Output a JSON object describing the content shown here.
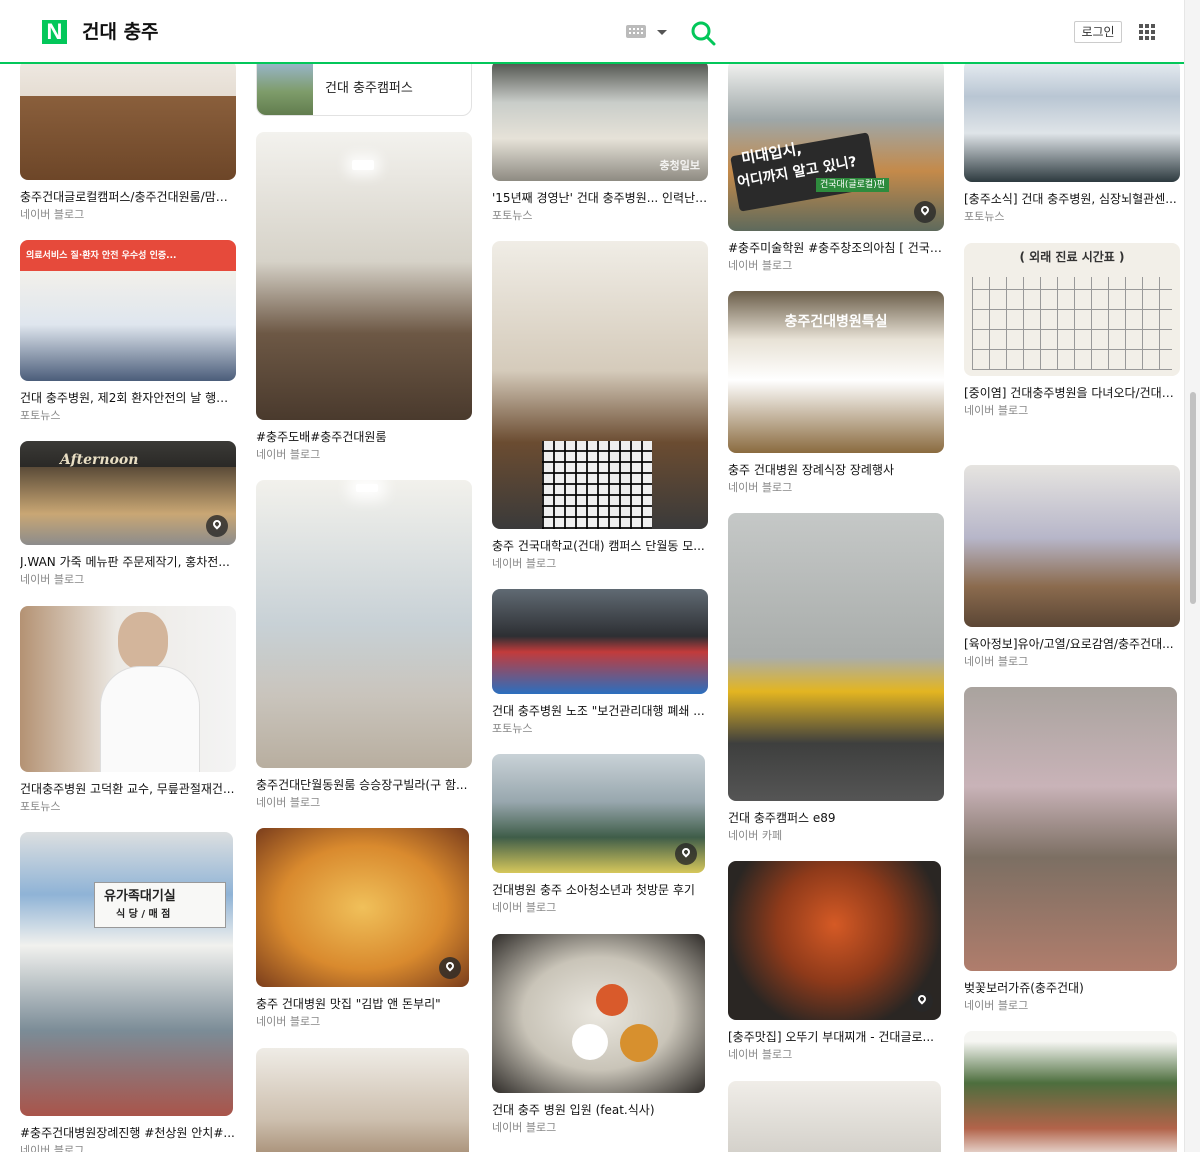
{
  "header": {
    "logo": "N",
    "query": "건대 충주",
    "login_label": "로그인"
  },
  "icons": {
    "keyboard": "keyboard-icon",
    "search": "search-icon",
    "apps": "grid-icon",
    "place": "map-pin-icon"
  },
  "colors": {
    "brand": "#03c75a"
  },
  "campus_card": {
    "label": "건대 충주캠퍼스"
  },
  "columns": [
    {
      "cards": [
        {
          "title": "충주건대글로컬캠퍼스/충주건대원룸/맘스...",
          "source": "네이버 블로그",
          "pin": false
        },
        {
          "title": "건대 충주병원, 제2회 환자안전의 날 행사...",
          "source": "포토뉴스",
          "pin": false
        },
        {
          "title": "J.WAN 가죽 메뉴판 주문제작기, 홍차전...",
          "source": "네이버 블로그",
          "pin": true
        },
        {
          "title": "건대충주병원 고덕환 교수, 무릎관절재건...",
          "source": "포토뉴스",
          "pin": false
        },
        {
          "title": "#충주건대병원장례진행 #천상원 안치#...",
          "source": "네이버 블로그",
          "pin": false
        }
      ]
    },
    {
      "cards": [
        {
          "title": "#충주도배#충주건대원룸",
          "source": "네이버 블로그",
          "pin": false
        },
        {
          "title": "충주건대단월동원룸 승승장구빌라(구 함...",
          "source": "네이버 블로그",
          "pin": false
        },
        {
          "title": "충주 건대병원 맛집 \"김밥 앤 돈부리\"",
          "source": "네이버 블로그",
          "pin": true
        },
        {
          "title": "",
          "source": "",
          "pin": false
        }
      ]
    },
    {
      "cards": [
        {
          "title": "'15년째 경영난' 건대 충주병원... 인력난·...",
          "source": "포토뉴스",
          "pin": false
        },
        {
          "title": "충주 건국대학교(건대) 캠퍼스 단월동 모...",
          "source": "네이버 블로그",
          "pin": false
        },
        {
          "title": "건대 충주병원 노조 \"보건관리대행 폐쇄 ...",
          "source": "포토뉴스",
          "pin": false
        },
        {
          "title": "건대병원 충주 소아청소년과 첫방문 후기",
          "source": "네이버 블로그",
          "pin": true
        },
        {
          "title": "건대 충주 병원 입원 (feat.식사)",
          "source": "네이버 블로그",
          "pin": false
        }
      ]
    },
    {
      "cards": [
        {
          "title": "#충주미술학원 #충주창조의아침 [ 건국대...",
          "source": "네이버 블로그",
          "pin": true
        },
        {
          "title": "충주 건대병원 장례식장 장례행사",
          "source": "네이버 블로그",
          "pin": false
        },
        {
          "title": "건대 충주캠퍼스 e89",
          "source": "네이버 카페",
          "pin": false
        },
        {
          "title": "[충주맛집] 오뚜기 부대찌개 - 건대글로...",
          "source": "네이버 블로그",
          "pin": true
        },
        {
          "title": "",
          "source": "",
          "pin": false
        }
      ]
    },
    {
      "cards": [
        {
          "title": "[충주소식] 건대 충주병원, 심장뇌혈관센...",
          "source": "포토뉴스",
          "pin": false
        },
        {
          "title": "[중이염] 건대충주병원을 다녀오다/건대충...",
          "source": "네이버 블로그",
          "pin": false
        },
        {
          "title": "[육아정보]유아/고열/요로감염/충주건대...",
          "source": "네이버 블로그",
          "pin": false
        },
        {
          "title": "벚꽃보러가쥬(충주건대)",
          "source": "네이버 블로그",
          "pin": false
        },
        {
          "title": "",
          "source": "",
          "pin": false
        }
      ]
    }
  ],
  "image_text": {
    "notice_banner": "의료서비스 질·환자 안전 우수성 인증...",
    "shop_sign": "Afternoon",
    "door_sign_1": "유가족대기실",
    "door_sign_2": "식 당 / 매 점",
    "building_ad_1": "미대입시,",
    "building_ad_2": "어디까지 알고 있니?",
    "building_tag": "건국대(글로컬)편",
    "funeral_sign": "충주건대병원특실",
    "timetable_title": "( 외래 진료 시간표 )",
    "watermark": "충청일보"
  }
}
